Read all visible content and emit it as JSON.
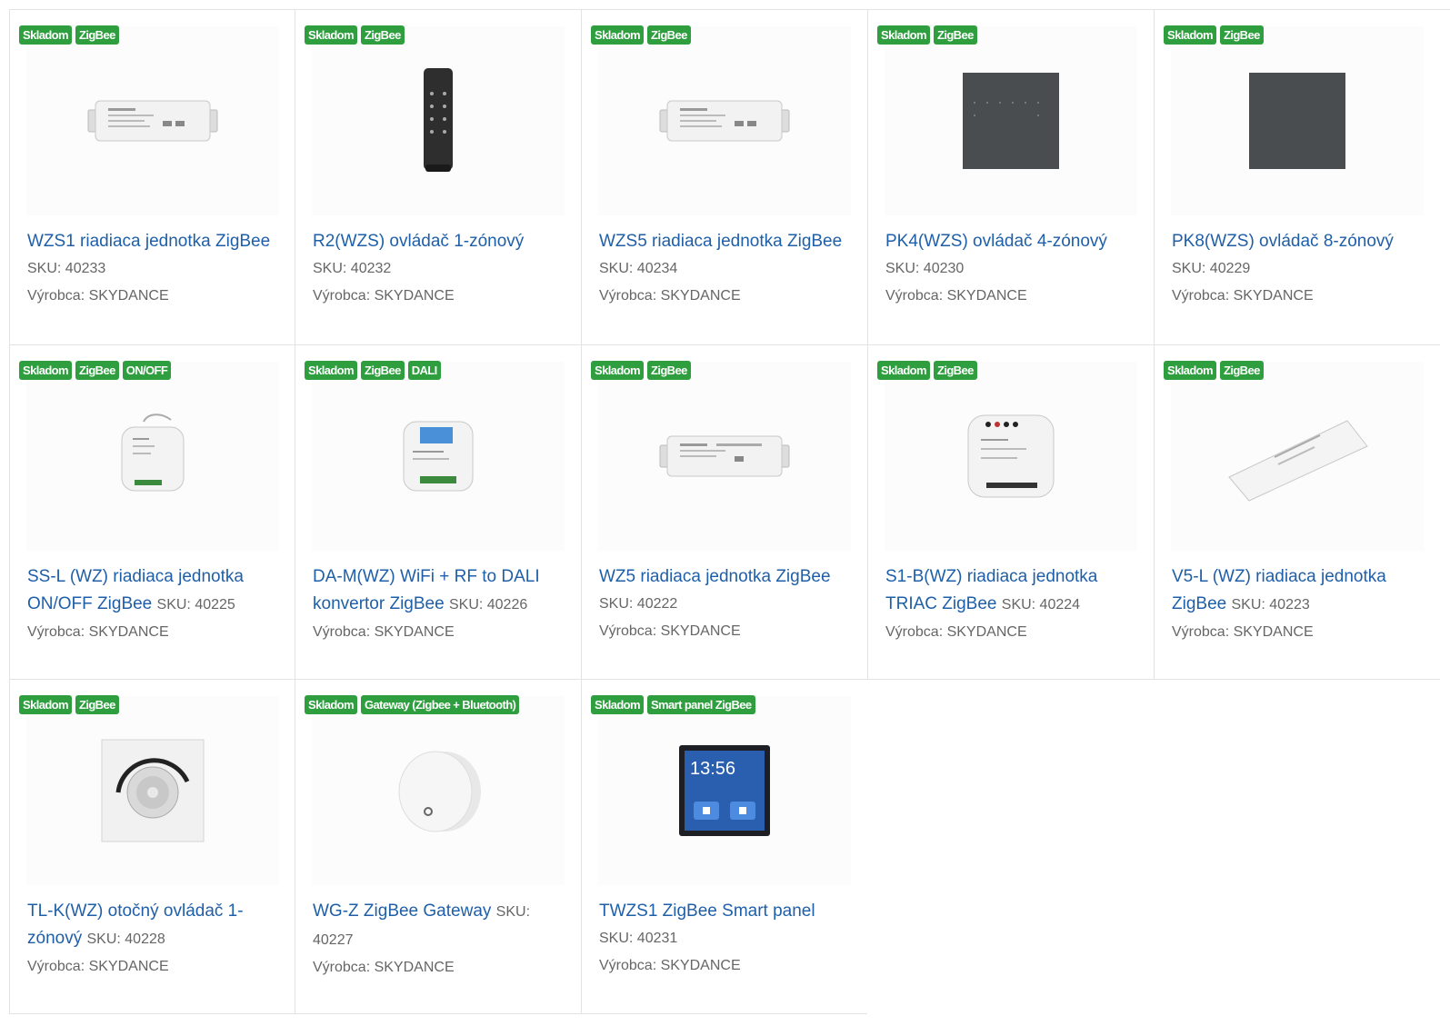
{
  "products": [
    {
      "badges": [
        "Skladom",
        "ZigBee"
      ],
      "title": "WZS1 riadiaca jednotka ZigBee",
      "sku": "SKU: 40233",
      "maker": "Výrobca: SKYDANCE",
      "image": "controller-box"
    },
    {
      "badges": [
        "Skladom",
        "ZigBee"
      ],
      "title": "R2(WZS) ovládač 1-zónový",
      "sku": "SKU: 40232",
      "maker": "Výrobca: SKYDANCE",
      "image": "remote"
    },
    {
      "badges": [
        "Skladom",
        "ZigBee"
      ],
      "title": "WZS5 riadiaca jednotka ZigBee",
      "sku": "SKU: 40234",
      "maker": "Výrobca: SKYDANCE",
      "image": "controller-box"
    },
    {
      "badges": [
        "Skladom",
        "ZigBee"
      ],
      "title": "PK4(WZS) ovládač 4-zónový",
      "sku": "SKU: 40230",
      "maker": "Výrobca: SKYDANCE",
      "image": "wall-panel"
    },
    {
      "badges": [
        "Skladom",
        "ZigBee"
      ],
      "title": "PK8(WZS) ovládač 8-zónový",
      "sku": "SKU: 40229",
      "maker": "Výrobca: SKYDANCE",
      "image": "wall-panel"
    },
    {
      "badges": [
        "Skladom",
        "ZigBee",
        "ON/OFF"
      ],
      "title": "SS-L (WZ) riadiaca jednotka ON/OFF ZigBee",
      "sku": "SKU: 40225",
      "maker": "Výrobca: SKYDANCE",
      "image": "round-module"
    },
    {
      "badges": [
        "Skladom",
        "ZigBee",
        "DALI"
      ],
      "title": "DA-M(WZ) WiFi + RF to DALI konvertor ZigBee",
      "sku": "SKU: 40226",
      "maker": "Výrobca: SKYDANCE",
      "image": "dali-module"
    },
    {
      "badges": [
        "Skladom",
        "ZigBee"
      ],
      "title": "WZ5 riadiaca jednotka ZigBee",
      "sku": "SKU: 40222",
      "maker": "Výrobca: SKYDANCE",
      "image": "controller-box"
    },
    {
      "badges": [
        "Skladom",
        "ZigBee"
      ],
      "title": "S1-B(WZ) riadiaca jednotka TRIAC ZigBee",
      "sku": "SKU: 40224",
      "maker": "Výrobca: SKYDANCE",
      "image": "triac-module"
    },
    {
      "badges": [
        "Skladom",
        "ZigBee"
      ],
      "title": "V5-L (WZ) riadiaca jednotka ZigBee",
      "sku": "SKU: 40223",
      "maker": "Výrobca: SKYDANCE",
      "image": "slim-driver"
    },
    {
      "badges": [
        "Skladom",
        "ZigBee"
      ],
      "title": "TL-K(WZ) otočný ovládač 1-zónový",
      "sku": "SKU: 40228",
      "maker": "Výrobca: SKYDANCE",
      "image": "rotary-dimmer"
    },
    {
      "badges": [
        "Skladom",
        "Gateway (Zigbee + Bluetooth)"
      ],
      "title": "WG-Z ZigBee Gateway",
      "sku": "SKU: 40227",
      "maker": "Výrobca: SKYDANCE",
      "image": "gateway"
    },
    {
      "badges": [
        "Skladom",
        "Smart panel ZigBee"
      ],
      "title": "TWZS1 ZigBee Smart panel",
      "sku": "SKU: 40231",
      "maker": "Výrobca: SKYDANCE",
      "image": "smart-panel",
      "screen_time": "13:56"
    }
  ],
  "colors": {
    "badge": "#2e9e3e",
    "title": "#1f5fa8",
    "meta": "#666666",
    "border": "#e3e3e3"
  }
}
